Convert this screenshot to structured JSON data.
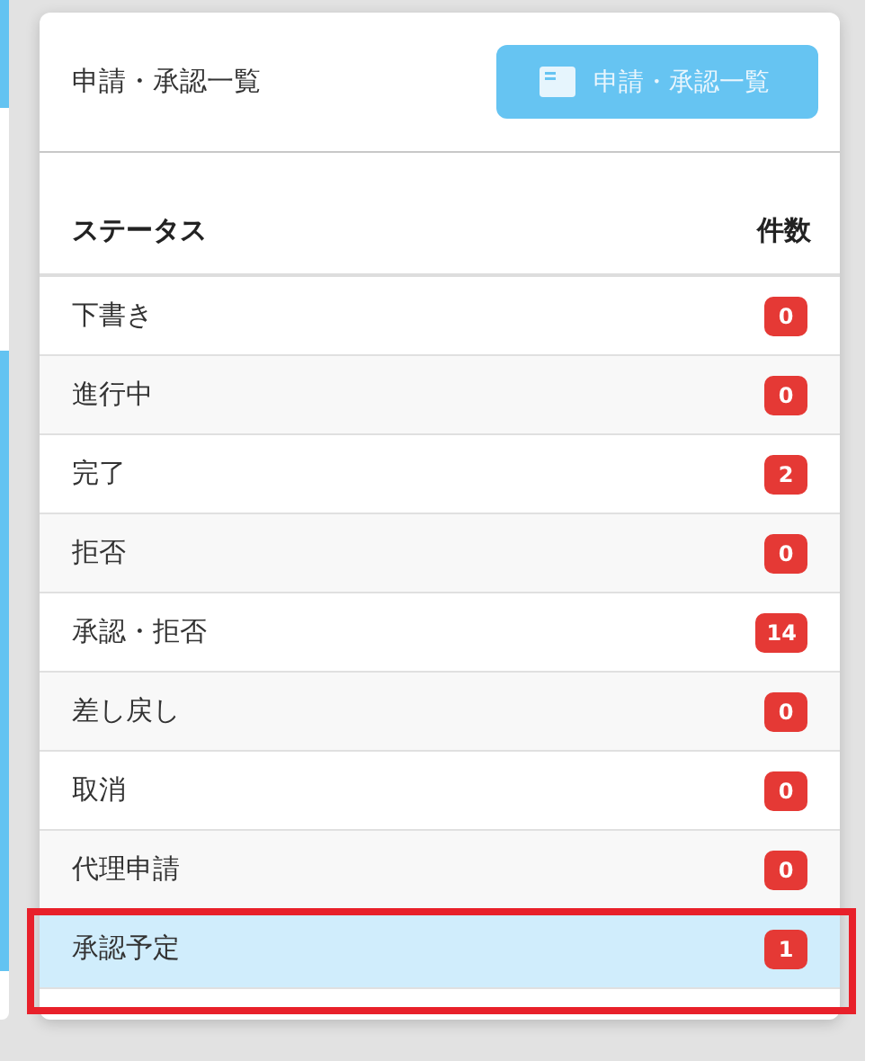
{
  "card": {
    "title": "申請・承認一覧",
    "button": "申請・承認一覧"
  },
  "table": {
    "columns": [
      "ステータス",
      "件数"
    ],
    "rows": [
      {
        "status": "下書き",
        "count": "0",
        "selected": false,
        "highlighted": false
      },
      {
        "status": "進行中",
        "count": "0",
        "selected": false,
        "highlighted": false
      },
      {
        "status": "完了",
        "count": "2",
        "selected": false,
        "highlighted": false
      },
      {
        "status": "拒否",
        "count": "0",
        "selected": false,
        "highlighted": false
      },
      {
        "status": "承認・拒否",
        "count": "14",
        "selected": false,
        "highlighted": false
      },
      {
        "status": "差し戻し",
        "count": "0",
        "selected": false,
        "highlighted": false
      },
      {
        "status": "取消",
        "count": "0",
        "selected": false,
        "highlighted": false
      },
      {
        "status": "代理申請",
        "count": "0",
        "selected": false,
        "highlighted": false
      },
      {
        "status": "承認予定",
        "count": "1",
        "selected": true,
        "highlighted": true
      }
    ]
  }
}
